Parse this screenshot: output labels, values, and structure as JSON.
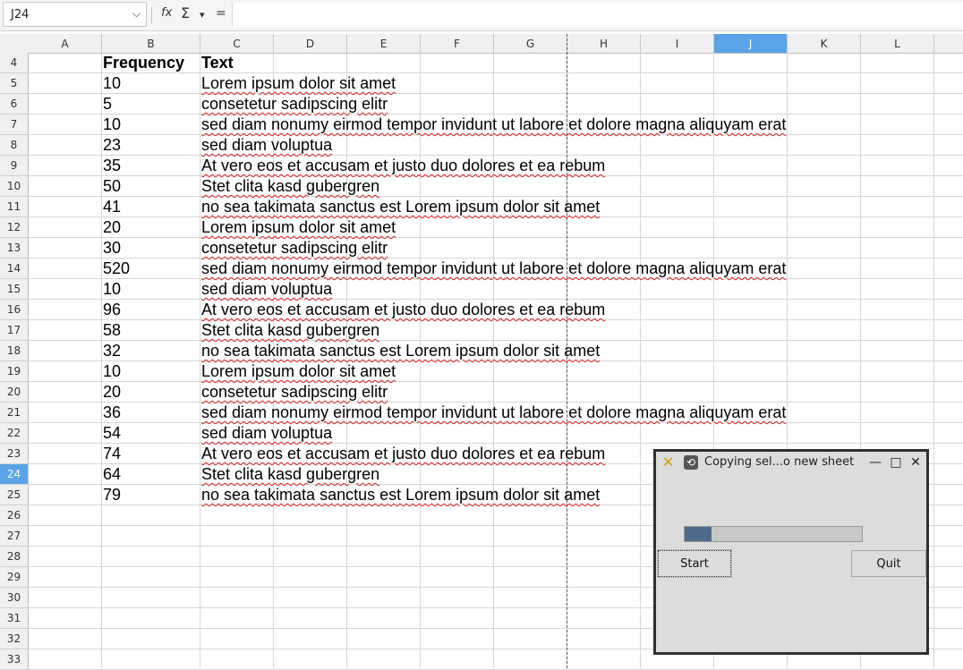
{
  "formula_bar": {
    "name_box": "J24",
    "icons": [
      "function-wizard-icon",
      "sum-icon",
      "chevron-down-icon",
      "formula-icon"
    ],
    "function_symbol": "fx",
    "sum_symbol": "Σ",
    "dropdown_symbol": "▾",
    "equals_symbol": "="
  },
  "columns": [
    "A",
    "B",
    "C",
    "D",
    "E",
    "F",
    "G",
    "H",
    "I",
    "J",
    "K",
    "L"
  ],
  "active_column": "J",
  "rows": [
    "4",
    "5",
    "6",
    "7",
    "8",
    "9",
    "10",
    "11",
    "12",
    "13",
    "14",
    "15",
    "16",
    "17",
    "18",
    "19",
    "20",
    "21",
    "22",
    "23",
    "24",
    "25",
    "26",
    "27",
    "28",
    "29",
    "30",
    "31",
    "32",
    "33"
  ],
  "active_row": "24",
  "headers": {
    "frequency": "Frequency",
    "text": "Text"
  },
  "table": [
    {
      "freq": "10",
      "text": "Lorem ipsum dolor sit amet"
    },
    {
      "freq": "5",
      "text": "consetetur sadipscing elitr"
    },
    {
      "freq": "10",
      "text": "sed diam nonumy eirmod tempor invidunt ut labore et dolore magna aliquyam erat"
    },
    {
      "freq": "23",
      "text": "sed diam voluptua"
    },
    {
      "freq": "35",
      "text": "At vero eos et accusam et justo duo dolores et ea rebum"
    },
    {
      "freq": "50",
      "text": "Stet clita kasd gubergren"
    },
    {
      "freq": "41",
      "text": "no sea takimata sanctus est Lorem ipsum dolor sit amet"
    },
    {
      "freq": "20",
      "text": "Lorem ipsum dolor sit amet"
    },
    {
      "freq": "30",
      "text": "consetetur sadipscing elitr"
    },
    {
      "freq": "520",
      "text": "sed diam nonumy eirmod tempor invidunt ut labore et dolore magna aliquyam erat"
    },
    {
      "freq": "10",
      "text": "sed diam voluptua"
    },
    {
      "freq": "96",
      "text": "At vero eos et accusam et justo duo dolores et ea rebum"
    },
    {
      "freq": "58",
      "text": "Stet clita kasd gubergren"
    },
    {
      "freq": "32",
      "text": "no sea takimata sanctus est Lorem ipsum dolor sit amet"
    },
    {
      "freq": "10",
      "text": "Lorem ipsum dolor sit amet"
    },
    {
      "freq": "20",
      "text": "consetetur sadipscing elitr"
    },
    {
      "freq": "36",
      "text": "sed diam nonumy eirmod tempor invidunt ut labore et dolore magna aliquyam erat"
    },
    {
      "freq": "54",
      "text": "sed diam voluptua"
    },
    {
      "freq": "74",
      "text": "At vero eos et accusam et justo duo dolores et ea rebum"
    },
    {
      "freq": "64",
      "text": "Stet clita kasd gubergren"
    },
    {
      "freq": "79",
      "text": "no sea takimata sanctus est Lorem ipsum dolor sit amet"
    }
  ],
  "dialog": {
    "title": "Copying sel...o new sheet",
    "progress_fraction": 0.15,
    "start_label": "Start",
    "quit_label": "Quit",
    "accent_color": "#4d6a8a"
  },
  "colors": {
    "selection": "#5aa3e8",
    "spellcheck": "#e02020"
  }
}
